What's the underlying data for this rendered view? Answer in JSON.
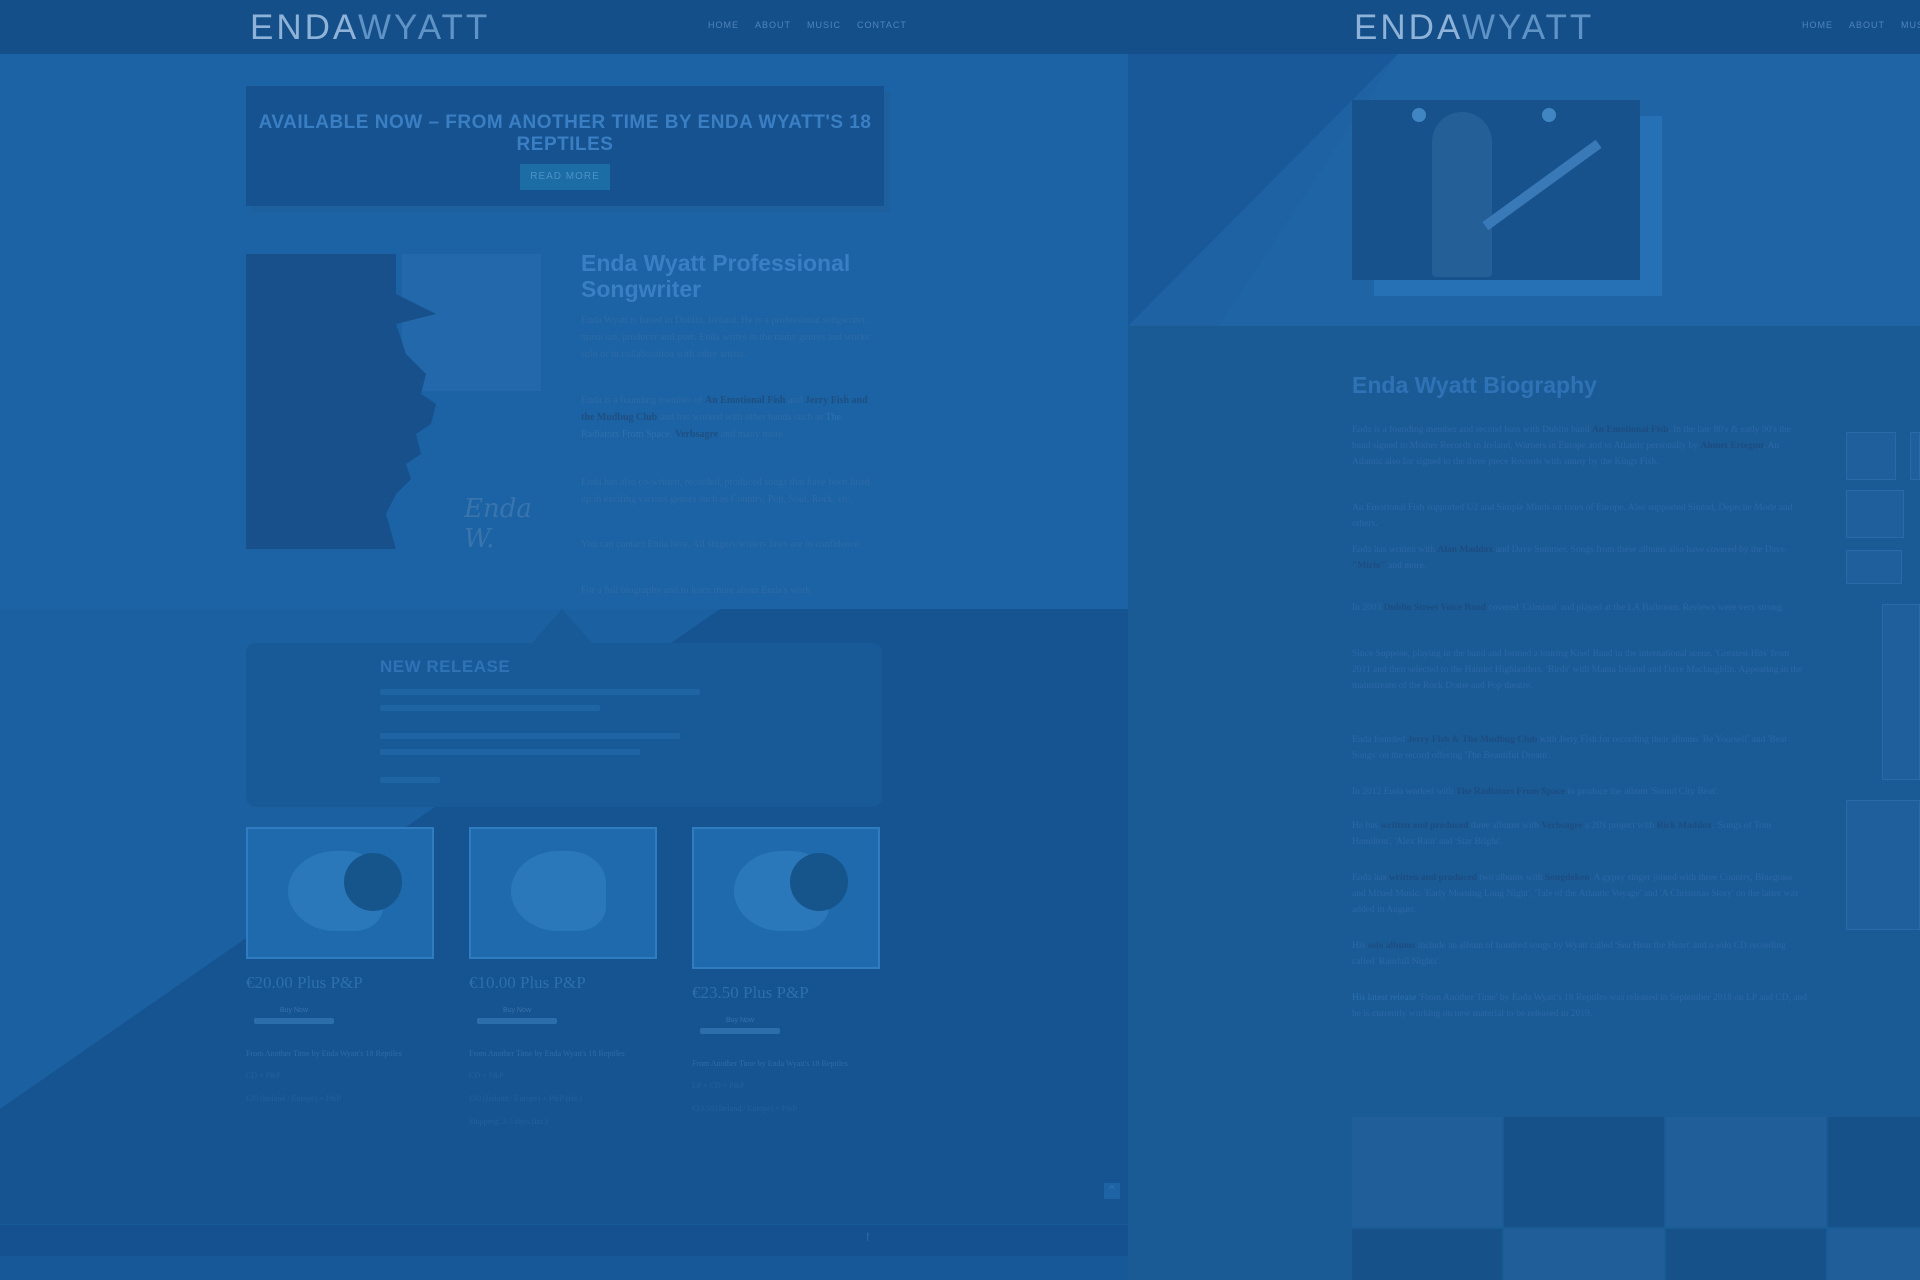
{
  "left": {
    "logo": {
      "part1": "ENDA",
      "part2": "WYATT"
    },
    "nav": [
      "HOME",
      "ABOUT",
      "MUSIC",
      "CONTACT"
    ],
    "promo": {
      "title": "AVAILABLE NOW – FROM ANOTHER TIME BY ENDA WYATT'S 18 REPTILES",
      "button": "READ MORE"
    },
    "signature": "Enda W.",
    "about": {
      "title": "Enda Wyatt Professional Songwriter",
      "p1": "Enda Wyatt is based in Dublin, Ireland. He is a professional songwriter, musician, producer and poet. Enda writes in the many genres and works solo or in collaboration with other artists.",
      "p2_pre": "Enda is a founding member of ",
      "p2_b1": "An Emotional Fish",
      "p2_mid": " and ",
      "p2_b2": "Jerry Fish and the Mudbug Club",
      "p2_post": " and has worked with other bands such as ",
      "p2_link": "The Radiators From Space",
      "p2_b3": "Verbsagre",
      "p2_end": " and many more.",
      "p3": "Enda has also co-written, recorded, produced songs that have been lined up in exciting various genres such as Country, Pop, Soul, Rock, etc.",
      "p4": "You can contact Enda here. All singers/writers lines are in confidence.",
      "p5": "For a full biography and to learn more about Enda's work"
    },
    "release": {
      "title": "NEW RELEASE"
    },
    "products": [
      {
        "price": "€20.00 Plus P&P",
        "buy": "Buy Now",
        "title": "From Another Time by Enda Wyatt's 18 Reptiles",
        "line2": "CD + P&P",
        "line3": "€20 (Ireland / Europe) + P&P"
      },
      {
        "price": "€10.00 Plus P&P",
        "buy": "Buy Now",
        "title": "From Another Time by Enda Wyatt's 18 Reptiles",
        "line2": "CD + P&P",
        "line3": "€10 (Ireland / Europe) + P&P (Int.)",
        "line4": "Shipping: 3-5 days (Int.)"
      },
      {
        "price": "€23.50 Plus P&P",
        "buy": "Buy Now",
        "title": "From Another Time by Enda Wyatt's 18 Reptiles",
        "line2": "LP + CD + P&P",
        "line3": "€23.50 (Ireland / Europe) + P&P"
      }
    ],
    "footer_icon": "f"
  },
  "right": {
    "logo": {
      "part1": "ENDA",
      "part2": "WYATT"
    },
    "nav": [
      "HOME",
      "ABOUT",
      "MUSIC"
    ],
    "bio": {
      "title": "Enda Wyatt Biography",
      "p1_pre": "Enda is a founding member and second bass with Dublin band ",
      "p1_b1": "An Emotional Fish",
      "p1_mid": ". In the late 80's & early 90's the band signed to Mother Records in Ireland, Warners in Europe and to Atlantic personally by ",
      "p1_b2": "Ahmet Ertegun",
      "p1_post": ". An Atlantic also for signed to the three piece Records with sunny by the Kings Fish.",
      "p2": "An Emotional Fish supported U2 and Simple Minds on tours of Europe. Also supported Sinéad, Depeche Mode and others.",
      "p3_pre": "Enda has written with ",
      "p3_b1": "Alan Maddox",
      "p3_mid": " and Dave Summer. Songs from these albums also have covered by the Dave ",
      "p3_b2": "\"Mirlo\"",
      "p3_post": " and more.",
      "p4_pre": "In 2003 ",
      "p4_b1": "Dublin Street Voice Band",
      "p4_post": " covered 'Criminal' and played at the LA Ballroom. Reviews were very strong.",
      "p5": "Since Suppose, playing in the band and formed a touring Kiss! Band in the international scene. 'Greatest Hits' from 2011 and then selected to the Hamlet Highlanders. 'Birds' with Mama Ireland and Dave Maclaughlin. Appearing in the mainstream of the Rock Dome and Pop theatre.",
      "p6_pre": "Enda founded ",
      "p6_b1": "Jerry Fish & The Mudbug Club",
      "p6_post": " with Jerry Fish for recording their albums 'Be Yourself' and 'Beat Songs' on the record offering 'The Beautiful Dream'.",
      "p7_pre": "In 2012 Enda worked with ",
      "p7_b1": "The Radiators From Space",
      "p7_post": " to produce the album 'Sound City Beat'.",
      "p8_pre": "He has ",
      "p8_b1": "written and produced",
      "p8_mid": " three albums with ",
      "p8_b2": "Verbsagre",
      "p8_mid2": " a 2IN project with ",
      "p8_b3": "Rick Maddox",
      "p8_post": ". 'Songs of Tom Hamilton', 'Alex Rain' and 'Star Bright'.",
      "p9_pre": "Enda has ",
      "p9_b1": "written and produced",
      "p9_mid": " two albums with ",
      "p9_b2": "Songdeken",
      "p9_post": ". A gypsy singer joined with three Country, Bluegrass and Mixed Music. 'Early Morning Long Night', 'Tale of the Atlantic Voyage' and 'A Christmas Story' on the latter was added in August.",
      "p10_pre": "His ",
      "p10_b1": "solo albums",
      "p10_post": " include an album of hundred songs by Wyatt called 'Sea Hear the Heart' and a solo CD recording called 'Rainfall Nights'.",
      "p11_pre": "",
      "p11_link": "His latest release",
      "p11_post": " 'From Another Time' by Enda Wyatt's 18 Reptiles was released in September 2018 on LP and CD, and he is currently working on new material to be released in 2019."
    }
  },
  "colors": {
    "tint": "#1a5b96",
    "accent": "#3a7fc4"
  }
}
